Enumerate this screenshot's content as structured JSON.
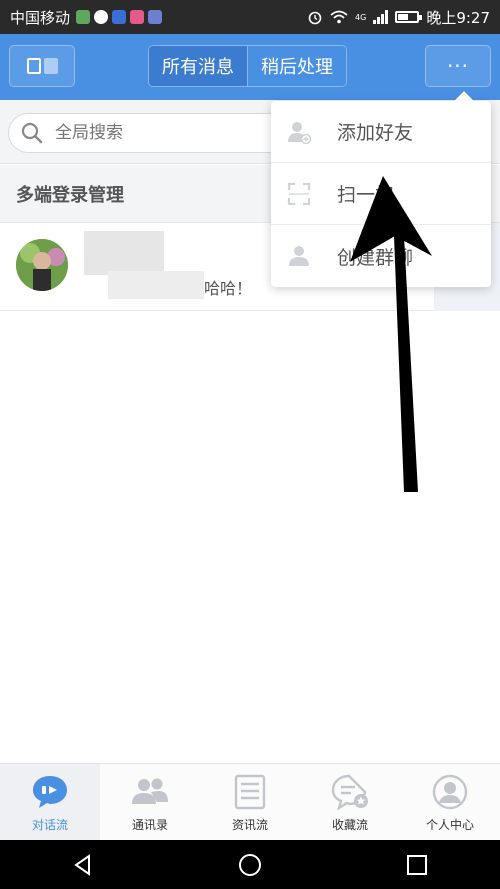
{
  "status_bar": {
    "carrier": "中国移动",
    "network": "4G",
    "time": "晚上9:27"
  },
  "header": {
    "tabs": [
      {
        "label": "所有消息"
      },
      {
        "label": "稍后处理"
      }
    ],
    "more_label": "···"
  },
  "search": {
    "placeholder": "全局搜索"
  },
  "section": {
    "title": "多端登录管理"
  },
  "conversation": {
    "preview": "哈哈！"
  },
  "dropdown": {
    "items": [
      {
        "label": "添加好友",
        "icon": "add-user-icon"
      },
      {
        "label": "扫一扫",
        "icon": "scan-icon"
      },
      {
        "label": "创建群聊",
        "icon": "group-chat-icon"
      }
    ]
  },
  "tabbar": {
    "items": [
      {
        "label": "对话流",
        "icon": "chat-icon"
      },
      {
        "label": "通讯录",
        "icon": "contacts-icon"
      },
      {
        "label": "资讯流",
        "icon": "news-icon"
      },
      {
        "label": "收藏流",
        "icon": "favorites-icon"
      },
      {
        "label": "个人中心",
        "icon": "profile-icon"
      }
    ]
  },
  "colors": {
    "accent": "#4a90e2",
    "statusbar": "#2a2a2a",
    "navbar": "#000000"
  }
}
